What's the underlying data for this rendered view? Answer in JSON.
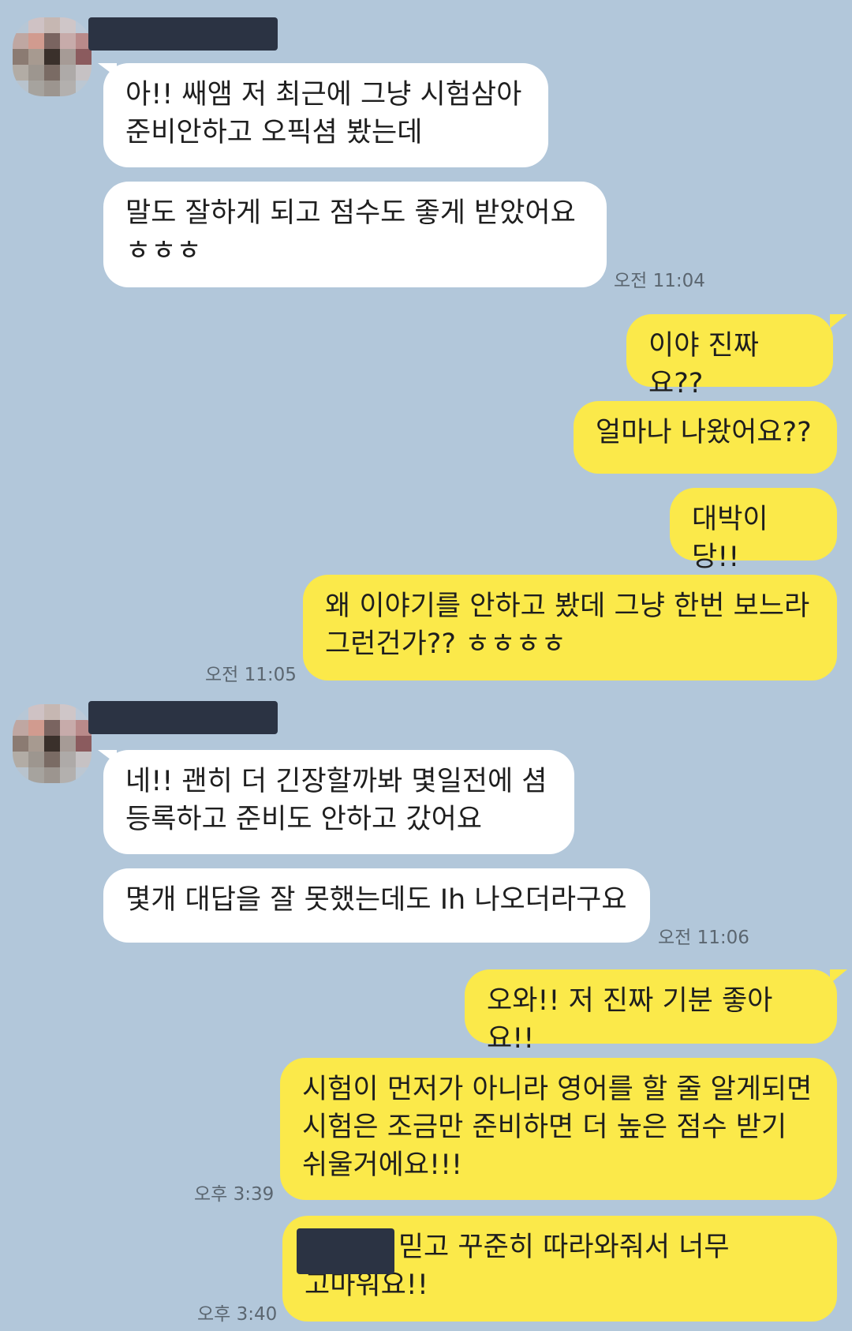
{
  "chat": {
    "messages": [
      {
        "side": "in",
        "text": "아!! 쌔앰 저 최근에 그냥 시험삼아\n준비안하고 오픽셤 봤는데"
      },
      {
        "side": "in",
        "text": "말도 잘하게 되고 점수도 좋게 받았어요\nㅎㅎㅎ",
        "time": "오전 11:04"
      },
      {
        "side": "out",
        "text": "이야 진짜요??"
      },
      {
        "side": "out",
        "text": "얼마나 나왔어요??"
      },
      {
        "side": "out",
        "text": "대박이당!!"
      },
      {
        "side": "out",
        "text": "왜 이야기를 안하고 봤데 그냥 한번 보느라\n그런건가?? ㅎㅎㅎㅎ",
        "time": "오전 11:05"
      },
      {
        "side": "in",
        "text": "네!! 괜히 더 긴장할까봐 몇일전에 셤\n등록하고 준비도 안하고 갔어요"
      },
      {
        "side": "in",
        "text": "몇개 대답을 잘 못했는데도 Ih 나오더라구요",
        "time": "오전 11:06"
      },
      {
        "side": "out",
        "text": "오와!! 저 진짜 기분 좋아요!!"
      },
      {
        "side": "out",
        "text": "시험이 먼저가 아니라 영어를 할 줄 알게되면\n시험은 조금만 준비하면 더 높은 점수 받기\n쉬울거에요!!!",
        "time": "오후 3:39"
      },
      {
        "side": "out",
        "text": "        가 저를 믿고 꾸준히 따라와줘서 너무\n고마워요!!",
        "time": "오후 3:40"
      }
    ]
  }
}
